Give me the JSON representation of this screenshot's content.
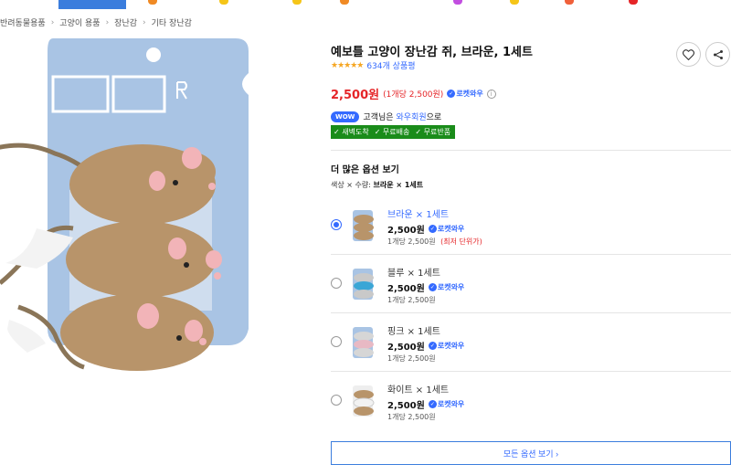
{
  "breadcrumb": [
    "반려동물용품",
    "고양이 용품",
    "장난감",
    "기타 장난감"
  ],
  "product": {
    "title": "예보틀 고양이 장난감 쥐, 브라운, 1세트",
    "stars": "★★★★★",
    "reviews": "634개 상품평",
    "price": "2,500원",
    "unit_price": "(1개당 2,500원)",
    "rocket_label": "로켓와우"
  },
  "wow": {
    "pill": "WOW",
    "text_before": "고객님은",
    "link": "와우회원",
    "text_after": "으로"
  },
  "benefits": [
    "✓ 새벽도착",
    "✓ 무료배송",
    "✓ 무료반품"
  ],
  "more_options": {
    "title": "더 많은 옵션 보기",
    "attr_label": "색상 × 수량:",
    "attr_value": "브라운 × 1세트"
  },
  "options": [
    {
      "name": "브라운 × 1세트",
      "price": "2,500원",
      "rocket": "로켓와우",
      "per": "1개당 2,500원",
      "lowest": "(최저 단위가)",
      "selected": true
    },
    {
      "name": "블루 × 1세트",
      "price": "2,500원",
      "rocket": "로켓와우",
      "per": "1개당 2,500원",
      "lowest": "",
      "selected": false
    },
    {
      "name": "핑크 × 1세트",
      "price": "2,500원",
      "rocket": "로켓와우",
      "per": "1개당 2,500원",
      "lowest": "",
      "selected": false
    },
    {
      "name": "화이트 × 1세트",
      "price": "2,500원",
      "rocket": "로켓와우",
      "per": "1개당 2,500원",
      "lowest": "",
      "selected": false
    }
  ],
  "all_options_button": "모든 옵션 보기 ›",
  "colors": {
    "accent": "#346aff",
    "price": "#e52528",
    "benefit_bg": "#1a8c1a",
    "card_bg": "#a9c4e4",
    "mouse": "#b8946a"
  },
  "icons": {
    "wishlist": "heart-icon",
    "share": "share-icon",
    "info": "info-icon",
    "rocket": "rocket-badge-icon"
  }
}
